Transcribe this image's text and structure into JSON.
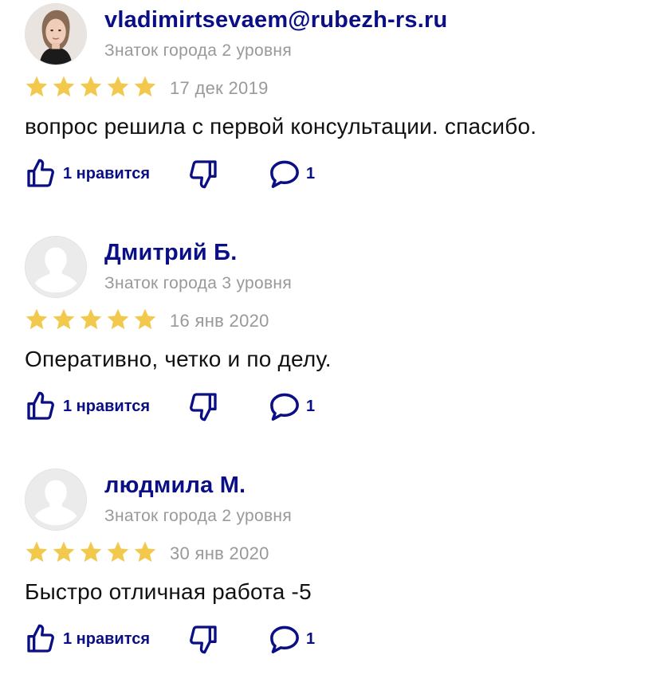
{
  "colors": {
    "author": "#0a0f86",
    "meta": "#999999",
    "star": "#f2c94c",
    "icon": "#0a0f86"
  },
  "reviews": [
    {
      "author": "vladimirtsevaem@rubezh-rs.ru",
      "level": "Знаток города 2 уровня",
      "rating": 5,
      "date": "17 дек 2019",
      "text": "вопрос решила с первой консультации. спасибо.",
      "like_label": "1 нравится",
      "comment_count": "1",
      "avatar": "photo"
    },
    {
      "author": "Дмитрий Б.",
      "level": "Знаток города 3 уровня",
      "rating": 5,
      "date": "16 янв 2020",
      "text": "Оперативно, четко и по делу.",
      "like_label": "1 нравится",
      "comment_count": "1",
      "avatar": "placeholder"
    },
    {
      "author": "людмила М.",
      "level": "Знаток города 2 уровня",
      "rating": 5,
      "date": "30 янв 2020",
      "text": "Быстро отличная работа -5",
      "like_label": "1 нравится",
      "comment_count": "1",
      "avatar": "placeholder"
    }
  ],
  "icons": {
    "like": "thumbs-up-icon",
    "dislike": "thumbs-down-icon",
    "comment": "comment-bubble-icon",
    "star": "star-icon"
  }
}
